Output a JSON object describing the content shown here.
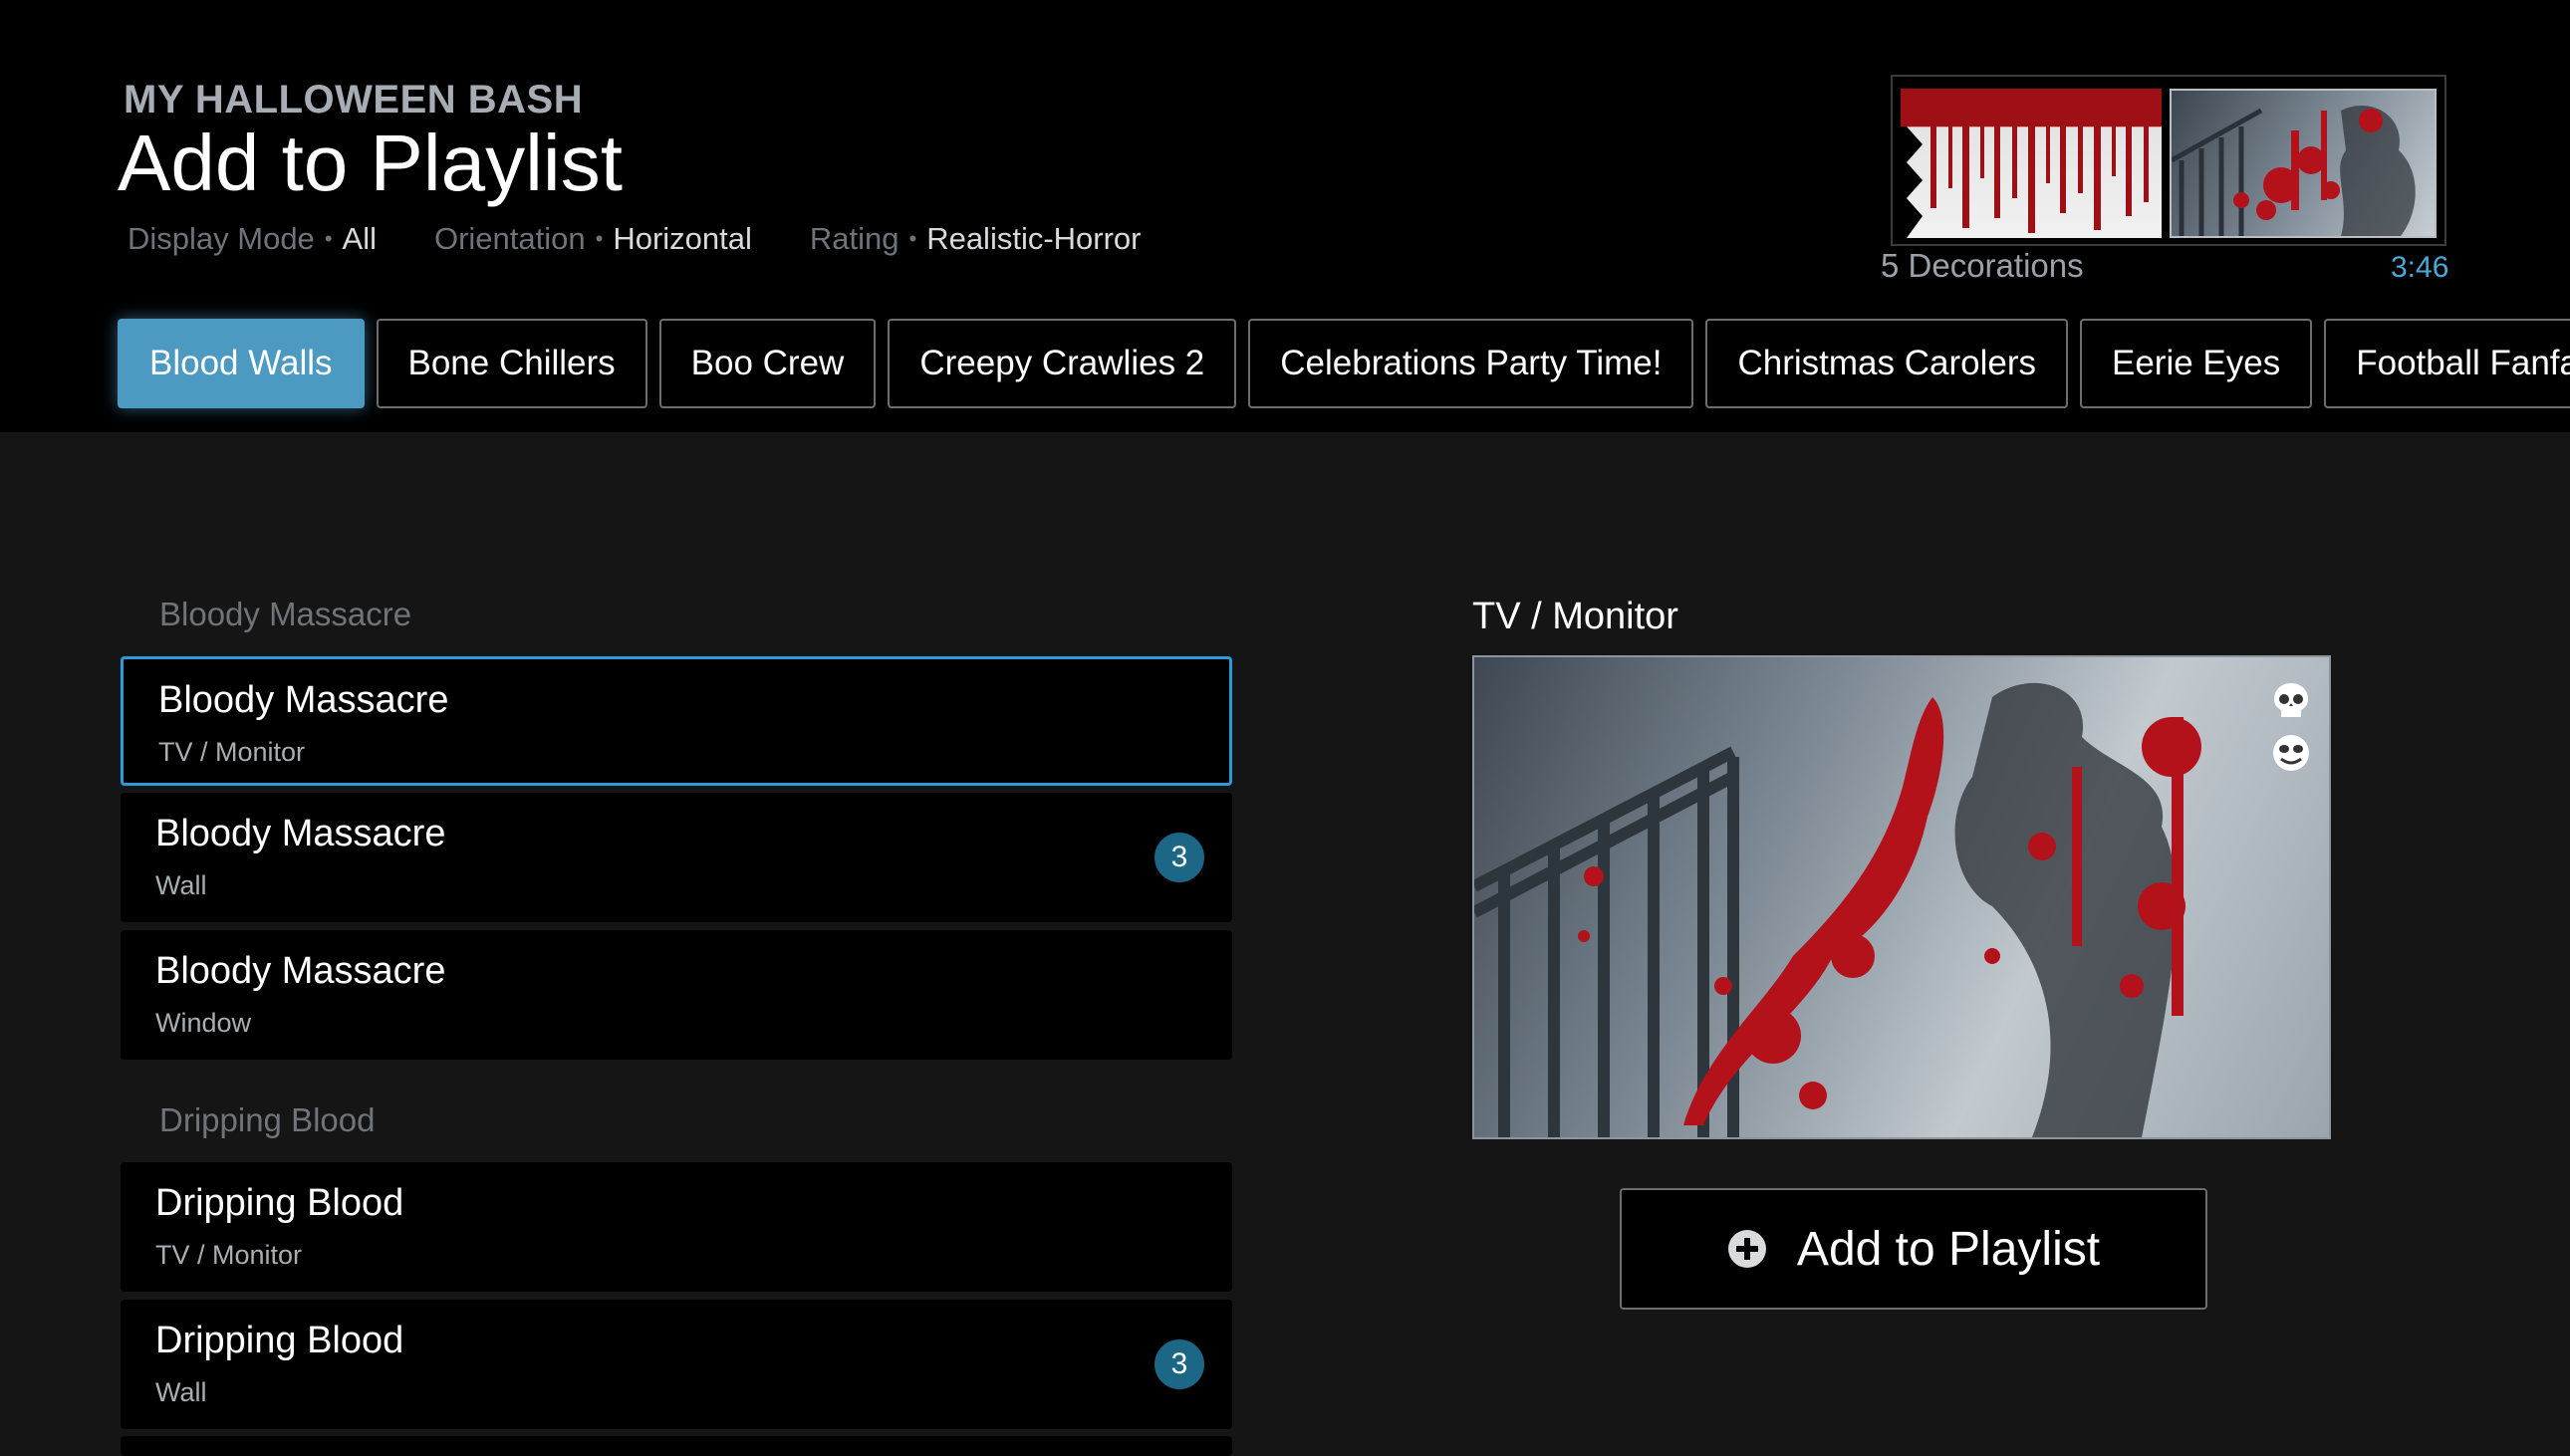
{
  "header": {
    "project": "MY HALLOWEEN BASH",
    "title": "Add to Playlist",
    "filters": [
      {
        "label": "Display Mode",
        "value": "All"
      },
      {
        "label": "Orientation",
        "value": "Horizontal"
      },
      {
        "label": "Rating",
        "value": "Realistic-Horror"
      }
    ],
    "separator": "•",
    "decorations": "5 Decorations",
    "duration": "3:46"
  },
  "tabs": [
    "Blood Walls",
    "Bone Chillers",
    "Boo Crew",
    "Creepy Crawlies 2",
    "Celebrations Party Time!",
    "Christmas Carolers",
    "Eerie Eyes",
    "Football Fanfa"
  ],
  "active_tab": 0,
  "sections": [
    {
      "label": "Bloody Massacre"
    },
    {
      "label": "Dripping Blood"
    }
  ],
  "rows": [
    {
      "name": "Bloody Massacre",
      "sub": "TV / Monitor",
      "badge": ""
    },
    {
      "name": "Bloody Massacre",
      "sub": "Wall",
      "badge": "3"
    },
    {
      "name": "Bloody Massacre",
      "sub": "Window",
      "badge": ""
    },
    {
      "name": "Dripping Blood",
      "sub": "TV / Monitor",
      "badge": ""
    },
    {
      "name": "Dripping Blood",
      "sub": "Wall",
      "badge": "3"
    }
  ],
  "preview": {
    "label": "TV / Monitor",
    "icons": [
      "skull-icon",
      "mask-icon"
    ]
  },
  "add_button": {
    "label": "Add to Playlist",
    "icon": "plus-circle-icon"
  },
  "colors": {
    "accent": "#4c99c2",
    "selection": "#2a9ad8",
    "badge": "#1c6786",
    "blood": "#b3121a"
  }
}
